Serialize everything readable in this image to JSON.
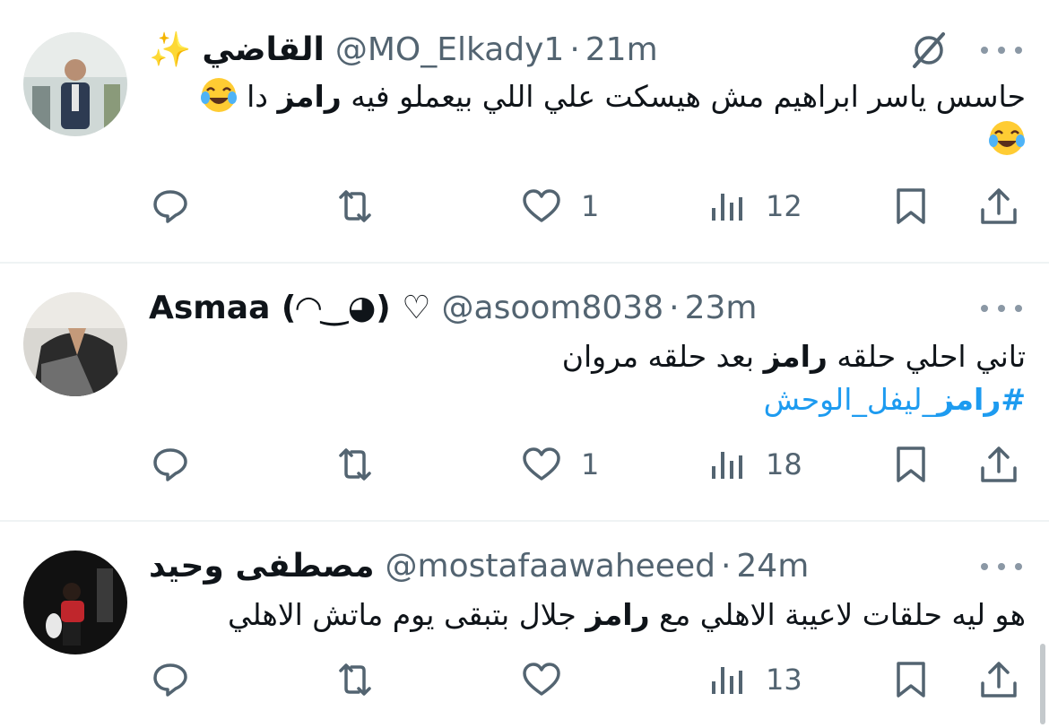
{
  "tweets": [
    {
      "display_name": "القاضي",
      "name_emoji": "✨",
      "handle": "@MO_Elkady1",
      "separator": "·",
      "time": "21m",
      "text_part1": "حاسس ياسر ابراهيم مش هيسكت علي اللي بيعملو فيه ",
      "text_bold": "رامز",
      "text_part2": " دا",
      "icons": {
        "avatar": "avatar-photo",
        "grok": "grok-icon",
        "more": "more-icon",
        "emoji": "joy-emoji"
      },
      "actions": {
        "reply": "",
        "retweet": "",
        "like": "1",
        "views": "12"
      }
    },
    {
      "display_name": "Asmaa (◠‿◕) ♡",
      "handle": "@asoom8038",
      "separator": "·",
      "time": "23m",
      "text_part1": "تاني احلي حلقه ",
      "text_bold": "رامز",
      "text_part2": " بعد حلقه مروان",
      "hashtag_bold": "#رامز",
      "hashtag_rest": "_ليفل_الوحش",
      "actions": {
        "reply": "",
        "retweet": "",
        "like": "1",
        "views": "18"
      }
    },
    {
      "display_name": "مصطفى وحيد",
      "handle": "@mostafaawaheeed",
      "separator": "·",
      "time": "24m",
      "text_part1": "هو ليه حلقات لاعيبة الاهلي مع ",
      "text_bold": "رامز",
      "text_part2": " جلال بتبقى يوم ماتش الاهلي",
      "actions": {
        "reply": "",
        "retweet": "",
        "like": "",
        "views": "13"
      }
    }
  ],
  "colors": {
    "text": "#0f1419",
    "muted": "#536471",
    "link": "#1d9bf0",
    "divider": "#eff3f4"
  }
}
